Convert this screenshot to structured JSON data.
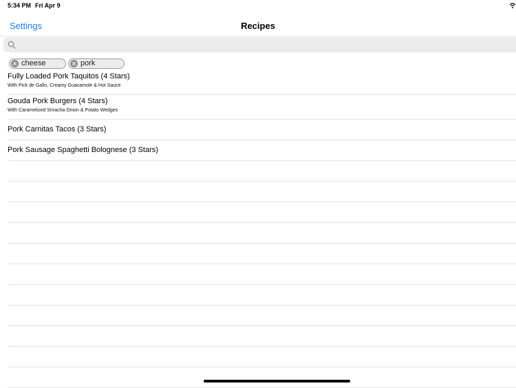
{
  "status_bar": {
    "time": "5:34 PM",
    "date": "Fri Apr 9"
  },
  "nav": {
    "settings_label": "Settings",
    "title": "Recipes"
  },
  "search": {
    "value": "",
    "placeholder": ""
  },
  "tokens": [
    {
      "label": "cheese"
    },
    {
      "label": "pork"
    }
  ],
  "recipes": [
    {
      "title": "Fully Loaded Pork Taquitos (4 Stars)",
      "subtitle": "With Pick de Gallo, Creamy Guacamole & Hot Sauce"
    },
    {
      "title": "Gouda Pork Burgers (4 Stars)",
      "subtitle": "With Caramelized Sriracha Onion & Potato Wedges"
    },
    {
      "title": "Pork Carnitas Tacos (3 Stars)"
    },
    {
      "title": "Pork Sausage Spaghetti Bolognese (3 Stars)"
    }
  ],
  "colors": {
    "accent": "#1a7ef0",
    "separator": "#e3e3e6",
    "search_bg": "#ececee"
  }
}
